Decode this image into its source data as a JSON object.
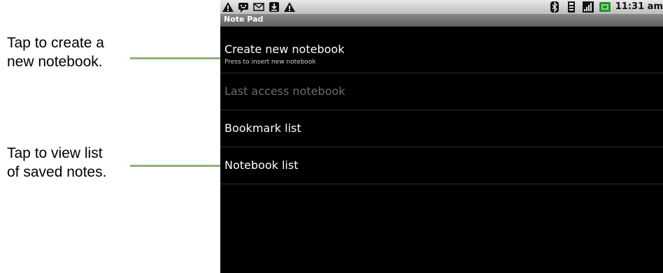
{
  "callouts": {
    "create": {
      "line1": "Tap to create a",
      "line2": "new notebook."
    },
    "view": {
      "line1": "Tap to view list",
      "line2": "of saved notes."
    }
  },
  "status_bar": {
    "left_icons": [
      "warning-icon",
      "chat-icon",
      "mail-icon",
      "download-icon",
      "warning-icon"
    ],
    "right_icons": [
      "bluetooth-icon",
      "wifi-icon",
      "signal-icon",
      "battery-icon"
    ],
    "time": "11:31 am"
  },
  "app": {
    "title": "Note Pad",
    "items": [
      {
        "label": "Create new notebook",
        "sublabel": "Press to insert new notebook",
        "enabled": true
      },
      {
        "label": "Last access notebook",
        "enabled": false
      },
      {
        "label": "Bookmark list",
        "enabled": true
      },
      {
        "label": "Notebook list",
        "enabled": true
      }
    ]
  },
  "colors": {
    "leader_line": "#8fb07a",
    "screen_bg": "#000000",
    "disabled_text": "#6b6b6b"
  }
}
